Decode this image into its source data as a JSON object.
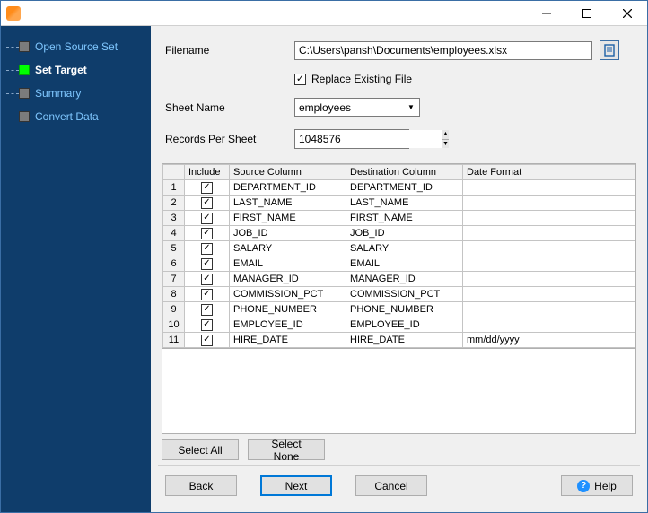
{
  "sidebar": {
    "items": [
      {
        "label": "Open Source Set",
        "active": false
      },
      {
        "label": "Set Target",
        "active": true
      },
      {
        "label": "Summary",
        "active": false
      },
      {
        "label": "Convert Data",
        "active": false
      }
    ]
  },
  "form": {
    "filename_label": "Filename",
    "filename_value": "C:\\Users\\pansh\\Documents\\employees.xlsx",
    "replace_label": "Replace Existing File",
    "replace_checked": true,
    "sheet_label": "Sheet Name",
    "sheet_value": "employees",
    "records_label": "Records Per Sheet",
    "records_value": "1048576"
  },
  "grid": {
    "headers": {
      "include": "Include",
      "source": "Source Column",
      "destination": "Destination Column",
      "date_format": "Date Format"
    },
    "rows": [
      {
        "n": "1",
        "include": true,
        "source": "DEPARTMENT_ID",
        "destination": "DEPARTMENT_ID",
        "date_format": ""
      },
      {
        "n": "2",
        "include": true,
        "source": "LAST_NAME",
        "destination": "LAST_NAME",
        "date_format": ""
      },
      {
        "n": "3",
        "include": true,
        "source": "FIRST_NAME",
        "destination": "FIRST_NAME",
        "date_format": ""
      },
      {
        "n": "4",
        "include": true,
        "source": "JOB_ID",
        "destination": "JOB_ID",
        "date_format": ""
      },
      {
        "n": "5",
        "include": true,
        "source": "SALARY",
        "destination": "SALARY",
        "date_format": ""
      },
      {
        "n": "6",
        "include": true,
        "source": "EMAIL",
        "destination": "EMAIL",
        "date_format": ""
      },
      {
        "n": "7",
        "include": true,
        "source": "MANAGER_ID",
        "destination": "MANAGER_ID",
        "date_format": ""
      },
      {
        "n": "8",
        "include": true,
        "source": "COMMISSION_PCT",
        "destination": "COMMISSION_PCT",
        "date_format": ""
      },
      {
        "n": "9",
        "include": true,
        "source": "PHONE_NUMBER",
        "destination": "PHONE_NUMBER",
        "date_format": ""
      },
      {
        "n": "10",
        "include": true,
        "source": "EMPLOYEE_ID",
        "destination": "EMPLOYEE_ID",
        "date_format": ""
      },
      {
        "n": "11",
        "include": true,
        "source": "HIRE_DATE",
        "destination": "HIRE_DATE",
        "date_format": "mm/dd/yyyy"
      }
    ]
  },
  "buttons": {
    "select_all": "Select All",
    "select_none": "Select None",
    "back": "Back",
    "next": "Next",
    "cancel": "Cancel",
    "help": "Help"
  }
}
